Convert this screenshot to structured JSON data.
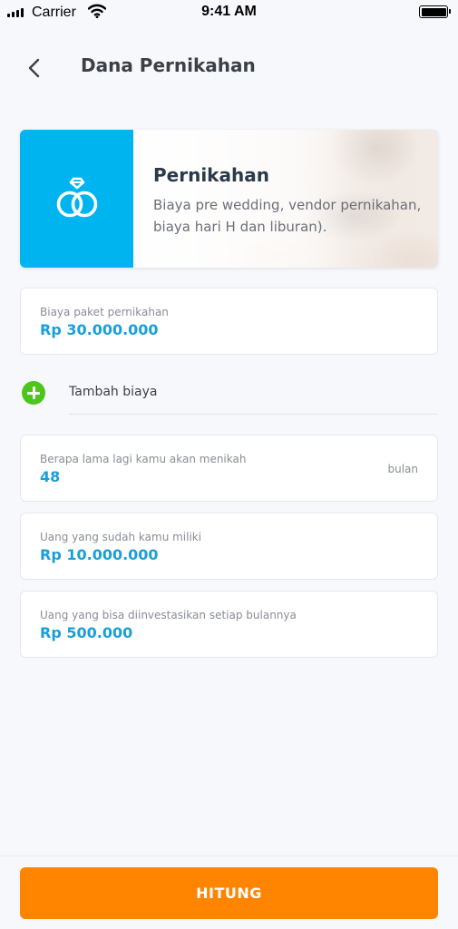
{
  "status_bar": {
    "carrier": "Carrier",
    "time": "9:41 AM"
  },
  "header": {
    "title": "Dana Pernikahan"
  },
  "banner": {
    "icon": "wedding-rings-icon",
    "title": "Pernikahan",
    "description": "Biaya pre wedding, vendor pernikahan, biaya hari H dan liburan).",
    "accent_color": "#00b4f0"
  },
  "fields": {
    "package_cost": {
      "label": "Biaya paket pernikahan",
      "value": "Rp 30.000.000"
    },
    "add_cost": {
      "label": "Tambah biaya",
      "icon": "plus-circle-icon",
      "color": "#4cc61a"
    },
    "months_until_wedding": {
      "label": "Berapa lama lagi kamu akan menikah",
      "value": "48",
      "unit": "bulan"
    },
    "current_savings": {
      "label": "Uang yang sudah kamu miliki",
      "value": "Rp 10.000.000"
    },
    "monthly_investment": {
      "label": "Uang yang bisa diinvestasikan setiap bulannya",
      "value": "Rp 500.000"
    }
  },
  "footer": {
    "button_label": "HITUNG",
    "button_color": "#ff8400"
  }
}
